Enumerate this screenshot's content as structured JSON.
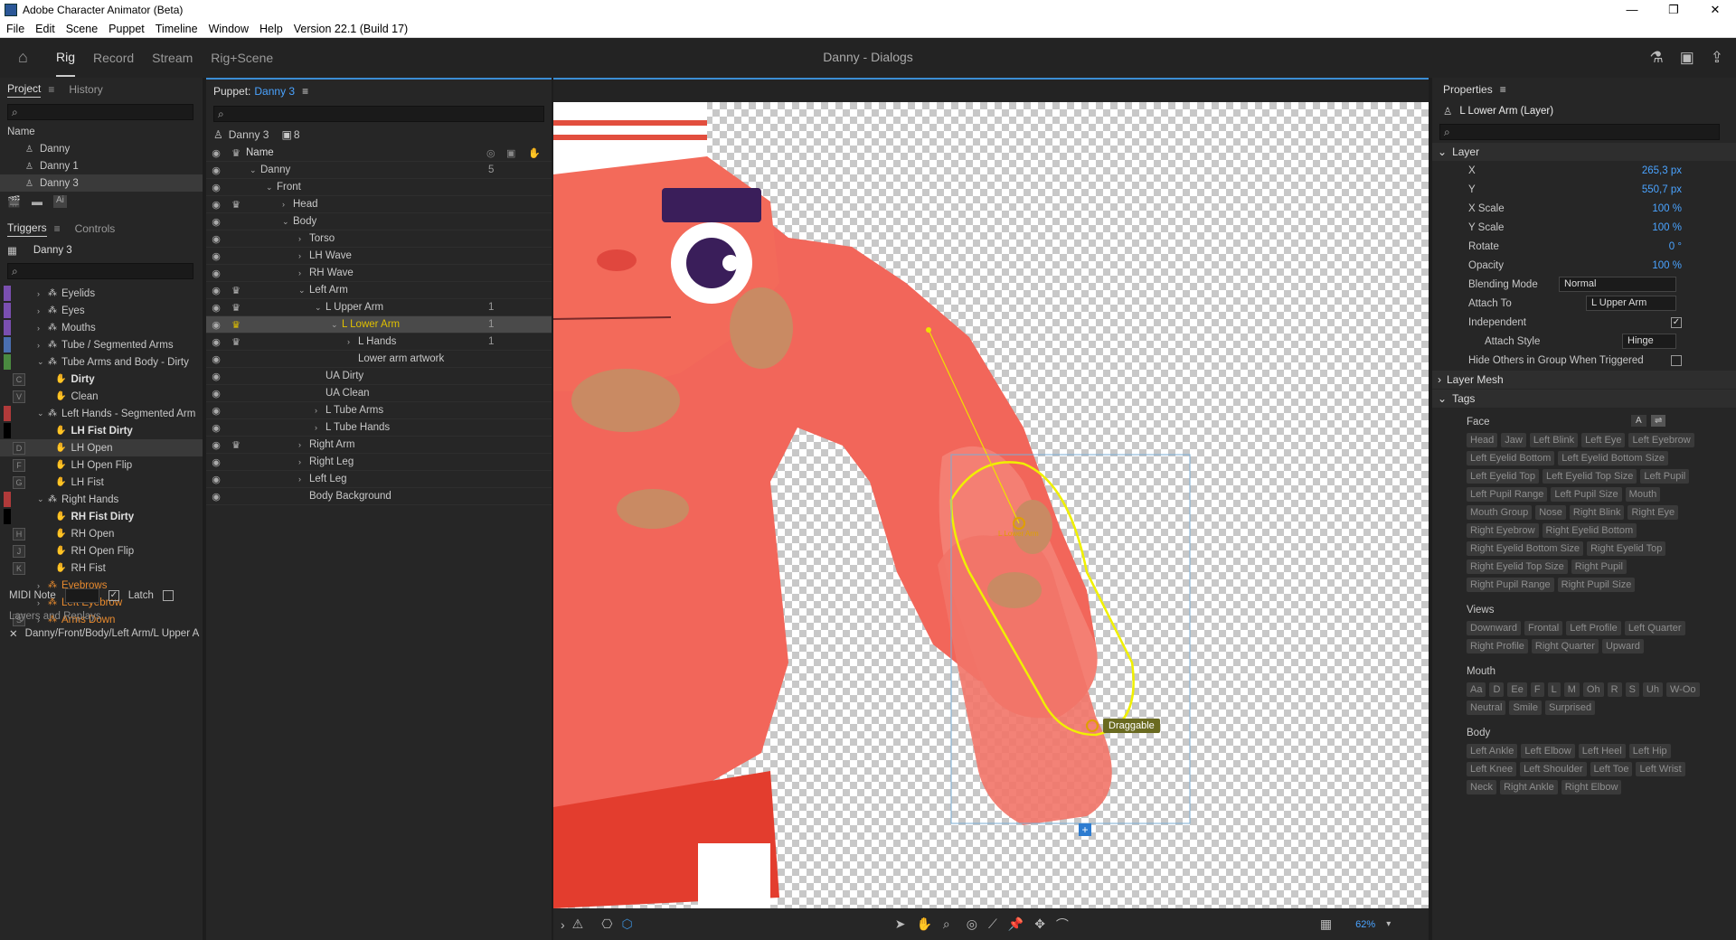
{
  "app": {
    "title": "Adobe Character Animator (Beta)",
    "doc_title": "Danny - Dialogs"
  },
  "menu": [
    "File",
    "Edit",
    "Scene",
    "Puppet",
    "Timeline",
    "Window",
    "Help",
    "Version 22.1 (Build 17)"
  ],
  "modes": [
    "Rig",
    "Record",
    "Stream",
    "Rig+Scene"
  ],
  "project": {
    "tabs": [
      "Project",
      "History"
    ],
    "col": "Name",
    "items": [
      "Danny",
      "Danny 1",
      "Danny 3"
    ]
  },
  "triggers": {
    "tabs": [
      "Triggers",
      "Controls"
    ],
    "puppet": "Danny 3",
    "rows": [
      {
        "label": "Eyelids",
        "color": "#7a4fb0",
        "key": "",
        "indent": 1,
        "cls": ""
      },
      {
        "label": "Eyes",
        "color": "#7a4fb0",
        "key": "",
        "indent": 1,
        "cls": ""
      },
      {
        "label": "Mouths",
        "color": "#7a4fb0",
        "key": "",
        "indent": 1,
        "cls": ""
      },
      {
        "label": "Tube / Segmented Arms",
        "color": "#4a6fb0",
        "key": "",
        "indent": 1,
        "cls": ""
      },
      {
        "label": "Tube Arms and Body - Dirty",
        "color": "#4a8a40",
        "key": "",
        "indent": 1,
        "cls": ""
      },
      {
        "label": "Dirty",
        "color": "",
        "key": "C",
        "indent": 3,
        "cls": "bold"
      },
      {
        "label": "Clean",
        "color": "",
        "key": "V",
        "indent": 3,
        "cls": ""
      },
      {
        "label": "Left Hands - Segmented Arm",
        "color": "#b03a3a",
        "key": "",
        "indent": 1,
        "cls": ""
      },
      {
        "label": "LH Fist Dirty",
        "color": "#000000",
        "key": "",
        "indent": 3,
        "cls": "bold"
      },
      {
        "label": "LH Open",
        "color": "",
        "key": "D",
        "indent": 3,
        "cls": "sel"
      },
      {
        "label": "LH Open Flip",
        "color": "",
        "key": "F",
        "indent": 3,
        "cls": ""
      },
      {
        "label": "LH Fist",
        "color": "",
        "key": "G",
        "indent": 3,
        "cls": ""
      },
      {
        "label": "Right Hands",
        "color": "#b03a3a",
        "key": "",
        "indent": 1,
        "cls": ""
      },
      {
        "label": "RH Fist Dirty",
        "color": "#000000",
        "key": "",
        "indent": 3,
        "cls": "bold"
      },
      {
        "label": "RH Open",
        "color": "",
        "key": "H",
        "indent": 3,
        "cls": ""
      },
      {
        "label": "RH Open Flip",
        "color": "",
        "key": "J",
        "indent": 3,
        "cls": ""
      },
      {
        "label": "RH Fist",
        "color": "",
        "key": "K",
        "indent": 3,
        "cls": ""
      },
      {
        "label": "Eyebrows",
        "color": "",
        "key": "",
        "indent": 1,
        "cls": "orange"
      },
      {
        "label": "Left Eyebrow",
        "color": "",
        "key": "",
        "indent": 1,
        "cls": "orange"
      },
      {
        "label": "Arms Down",
        "color": "",
        "key": "S",
        "indent": 1,
        "cls": "orange"
      }
    ],
    "midi_label": "MIDI Note",
    "latch": "Latch",
    "layers_title": "Layers and Replays",
    "layer_path": "Danny/Front/Body/Left Arm/L Upper A"
  },
  "puppet": {
    "label": "Puppet:",
    "name": "Danny 3",
    "sub": "Danny 3",
    "count": "8",
    "col": "Name",
    "rows": [
      {
        "label": "Danny",
        "indent": 0,
        "chev": "v",
        "num": "5",
        "crown": false
      },
      {
        "label": "Front",
        "indent": 1,
        "chev": "v",
        "num": "",
        "crown": false
      },
      {
        "label": "Head",
        "indent": 2,
        "chev": ">",
        "num": "",
        "crown": true
      },
      {
        "label": "Body",
        "indent": 2,
        "chev": "v",
        "num": "",
        "crown": false
      },
      {
        "label": "Torso",
        "indent": 3,
        "chev": ">",
        "num": "",
        "crown": false
      },
      {
        "label": "LH Wave",
        "indent": 3,
        "chev": ">",
        "num": "",
        "crown": false
      },
      {
        "label": "RH Wave",
        "indent": 3,
        "chev": ">",
        "num": "",
        "crown": false
      },
      {
        "label": "Left Arm",
        "indent": 3,
        "chev": "v",
        "num": "",
        "crown": true
      },
      {
        "label": "L Upper Arm",
        "indent": 4,
        "chev": "v",
        "num": "1",
        "crown": true
      },
      {
        "label": "L Lower Arm",
        "indent": 5,
        "chev": "v",
        "num": "1",
        "crown": true,
        "sel": true
      },
      {
        "label": "L Hands",
        "indent": 6,
        "chev": ">",
        "num": "1",
        "crown": true
      },
      {
        "label": "Lower arm artwork",
        "indent": 6,
        "chev": "",
        "num": "",
        "crown": false
      },
      {
        "label": "UA Dirty",
        "indent": 4,
        "chev": "",
        "num": "",
        "crown": false
      },
      {
        "label": "UA Clean",
        "indent": 4,
        "chev": "",
        "num": "",
        "crown": false
      },
      {
        "label": "L Tube Arms",
        "indent": 4,
        "chev": ">",
        "num": "",
        "crown": false
      },
      {
        "label": "L Tube Hands",
        "indent": 4,
        "chev": ">",
        "num": "",
        "crown": false
      },
      {
        "label": "Right Arm",
        "indent": 3,
        "chev": ">",
        "num": "",
        "crown": true
      },
      {
        "label": "Right Leg",
        "indent": 3,
        "chev": ">",
        "num": "",
        "crown": false
      },
      {
        "label": "Left Leg",
        "indent": 3,
        "chev": ">",
        "num": "",
        "crown": false
      },
      {
        "label": "Body Background",
        "indent": 3,
        "chev": "",
        "num": "",
        "crown": false
      }
    ]
  },
  "canvas": {
    "handle_label": "L Lower Arm",
    "draggable": "Draggable",
    "zoom": "62%"
  },
  "props": {
    "title": "Properties",
    "layer_name": "L Lower Arm (Layer)",
    "section_layer": "Layer",
    "x_label": "X",
    "x": "265,3 px",
    "y_label": "Y",
    "y": "550,7 px",
    "xs_label": "X Scale",
    "xs": "100 %",
    "ys_label": "Y Scale",
    "ys": "100 %",
    "rot_label": "Rotate",
    "rot": "0 °",
    "op_label": "Opacity",
    "op": "100 %",
    "blend_label": "Blending Mode",
    "blend": "Normal",
    "attach_label": "Attach To",
    "attach": "L Upper Arm",
    "indep_label": "Independent",
    "style_label": "Attach Style",
    "style": "Hinge",
    "hide_label": "Hide Others in Group When Triggered",
    "section_mesh": "Layer Mesh",
    "section_tags": "Tags",
    "face_title": "Face",
    "face_btn": "A",
    "face": [
      "Head",
      "Jaw",
      "Left Blink",
      "Left Eye",
      "Left Eyebrow",
      "Left Eyelid Bottom",
      "Left Eyelid Bottom Size",
      "Left Eyelid Top",
      "Left Eyelid Top Size",
      "Left Pupil",
      "Left Pupil Range",
      "Left Pupil Size",
      "Mouth",
      "Mouth Group",
      "Nose",
      "Right Blink",
      "Right Eye",
      "Right Eyebrow",
      "Right Eyelid Bottom",
      "Right Eyelid Bottom Size",
      "Right Eyelid Top",
      "Right Eyelid Top Size",
      "Right Pupil",
      "Right Pupil Range",
      "Right Pupil Size"
    ],
    "views_title": "Views",
    "views": [
      "Downward",
      "Frontal",
      "Left Profile",
      "Left Quarter",
      "Right Profile",
      "Right Quarter",
      "Upward"
    ],
    "mouth_title": "Mouth",
    "mouth": [
      "Aa",
      "D",
      "Ee",
      "F",
      "L",
      "M",
      "Oh",
      "R",
      "S",
      "Uh",
      "W-Oo",
      "Neutral",
      "Smile",
      "Surprised"
    ],
    "body_title": "Body",
    "body": [
      "Left Ankle",
      "Left Elbow",
      "Left Heel",
      "Left Hip",
      "Left Knee",
      "Left Shoulder",
      "Left Toe",
      "Left Wrist",
      "Neck",
      "Right Ankle",
      "Right Elbow"
    ]
  }
}
